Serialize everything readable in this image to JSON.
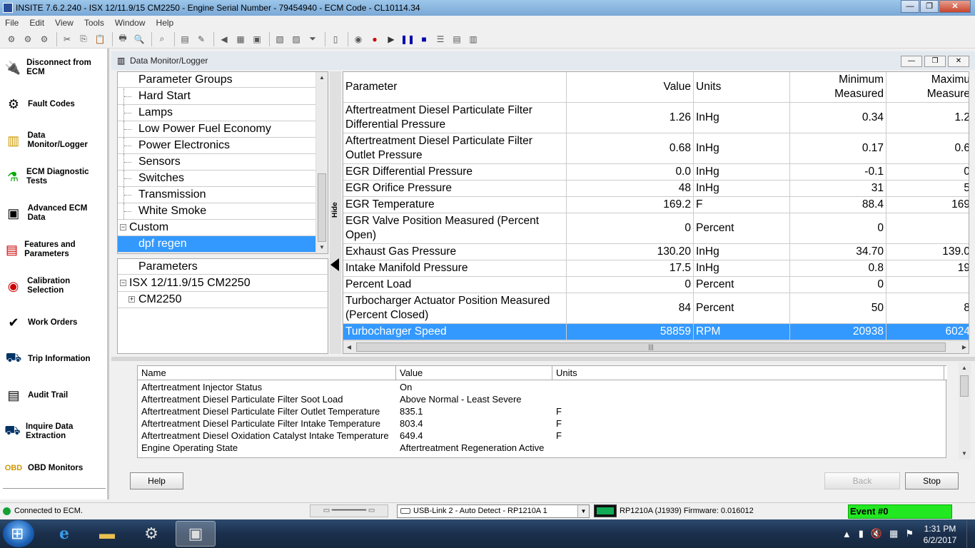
{
  "window": {
    "title": "INSITE 7.6.2.240  -  ISX 12/11.9/15 CM2250 - Engine Serial Number - 79454940 - ECM Code - CL10114.34"
  },
  "menu": [
    "File",
    "Edit",
    "View",
    "Tools",
    "Window",
    "Help"
  ],
  "sidebar": {
    "items": [
      {
        "label": "Disconnect from ECM",
        "icon": "disconnect-icon"
      },
      {
        "label": "Fault Codes",
        "icon": "fault-codes-icon"
      },
      {
        "label": "Data Monitor/Logger",
        "icon": "data-monitor-icon"
      },
      {
        "label": "ECM Diagnostic Tests",
        "icon": "diagnostic-tests-icon"
      },
      {
        "label": "Advanced ECM Data",
        "icon": "advanced-data-icon"
      },
      {
        "label": "Features and Parameters",
        "icon": "features-icon"
      },
      {
        "label": "Calibration Selection",
        "icon": "calibration-icon"
      },
      {
        "label": "Work Orders",
        "icon": "work-orders-icon"
      },
      {
        "label": "Trip Information",
        "icon": "trip-information-icon"
      },
      {
        "label": "Audit Trail",
        "icon": "audit-trail-icon"
      },
      {
        "label": "Inquire Data Extraction",
        "icon": "inquire-data-icon"
      },
      {
        "label": "OBD Monitors",
        "icon": "obd-icon"
      }
    ]
  },
  "child": {
    "title": "Data Monitor/Logger"
  },
  "param_groups": {
    "header": "Parameter Groups",
    "items": [
      "Hard Start",
      "Lamps",
      "Low Power Fuel Economy",
      "Power Electronics",
      "Sensors",
      "Switches",
      "Transmission",
      "White Smoke"
    ],
    "custom_label": "Custom",
    "custom_items": [
      "dpf regen"
    ]
  },
  "parameters": {
    "header": "Parameters",
    "root": "ISX 12/11.9/15 CM2250",
    "child": "CM2250"
  },
  "hide_label": "Hide",
  "grid": {
    "headers": {
      "parameter": "Parameter",
      "value": "Value",
      "units": "Units",
      "min_line1": "Minimum",
      "min_line2": "Measured",
      "max_line1": "Maximu",
      "max_line2": "Measure"
    },
    "rows": [
      {
        "name1": "Aftertreatment Diesel Particulate Filter",
        "name2": "Differential Pressure",
        "value": "1.26",
        "units": "InHg",
        "min": "0.34",
        "max": "1.2"
      },
      {
        "name1": "Aftertreatment Diesel Particulate Filter",
        "name2": "Outlet Pressure",
        "value": "0.68",
        "units": "InHg",
        "min": "0.17",
        "max": "0.6"
      },
      {
        "name1": "EGR Differential Pressure",
        "name2": "",
        "value": "0.0",
        "units": "InHg",
        "min": "-0.1",
        "max": "0"
      },
      {
        "name1": "EGR Orifice Pressure",
        "name2": "",
        "value": "48",
        "units": "InHg",
        "min": "31",
        "max": "5"
      },
      {
        "name1": "EGR Temperature",
        "name2": "",
        "value": "169.2",
        "units": "F",
        "min": "88.4",
        "max": "169"
      },
      {
        "name1": "EGR Valve Position Measured (Percent",
        "name2": "Open)",
        "value": "0",
        "units": "Percent",
        "min": "0",
        "max": ""
      },
      {
        "name1": "Exhaust Gas Pressure",
        "name2": "",
        "value": "130.20",
        "units": "InHg",
        "min": "34.70",
        "max": "139.0"
      },
      {
        "name1": "Intake Manifold Pressure",
        "name2": "",
        "value": "17.5",
        "units": "InHg",
        "min": "0.8",
        "max": "19"
      },
      {
        "name1": "Percent Load",
        "name2": "",
        "value": "0",
        "units": "Percent",
        "min": "0",
        "max": ""
      },
      {
        "name1": "Turbocharger Actuator Position Measured",
        "name2": "(Percent Closed)",
        "value": "84",
        "units": "Percent",
        "min": "50",
        "max": "8"
      },
      {
        "name1": "Turbocharger Speed",
        "name2": "",
        "value": "58859",
        "units": "RPM",
        "min": "20938",
        "max": "6024"
      }
    ]
  },
  "bottom_list": {
    "headers": {
      "name": "Name",
      "value": "Value",
      "units": "Units"
    },
    "rows": [
      {
        "name": "Aftertreatment Injector Status",
        "value": "On",
        "units": ""
      },
      {
        "name": "Aftertreatment Diesel Particulate Filter Soot Load",
        "value": "Above Normal - Least Severe",
        "units": ""
      },
      {
        "name": "Aftertreatment Diesel Particulate Filter Outlet Temperature",
        "value": "835.1",
        "units": "F"
      },
      {
        "name": "Aftertreatment Diesel Particulate Filter Intake Temperature",
        "value": "803.4",
        "units": "F"
      },
      {
        "name": "Aftertreatment Diesel Oxidation Catalyst Intake Temperature",
        "value": "649.4",
        "units": "F"
      },
      {
        "name": "Engine Operating State",
        "value": "Aftertreatment Regeneration Active",
        "units": ""
      }
    ]
  },
  "buttons": {
    "help": "Help",
    "back": "Back",
    "stop": "Stop"
  },
  "status": {
    "connection": "Connected to ECM.",
    "adapter": "USB-Link 2 - Auto Detect - RP1210A 1",
    "firmware": "RP1210A (J1939)   Firmware: 0.016012",
    "event": "Event #0"
  },
  "taskbar": {
    "time": "1:31 PM",
    "date": "6/2/2017"
  },
  "colors": {
    "selection": "#3399ff",
    "event_bg": "#22e822",
    "connected_led": "#1b9e2a"
  }
}
